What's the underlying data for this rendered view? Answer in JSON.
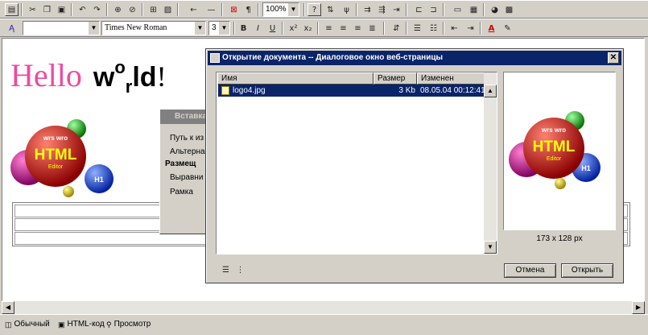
{
  "toolbar1": {
    "zoom": "100%"
  },
  "toolbar2": {
    "style_value": "",
    "font_value": "Times New Roman",
    "size_value": "3"
  },
  "document": {
    "hello": "Hello",
    "w": "w",
    "o": "o",
    "r": "r",
    "ld": "ld",
    "bang": "!",
    "logo_html": "HTML",
    "logo_editor": "Editor",
    "logo_small": "wrs wro",
    "logo_h1": "H1"
  },
  "bg_dialog": {
    "title": "Вставка",
    "labels": [
      "Путь к из",
      "Альтерна",
      "Размещ",
      "Выравни",
      "Рамка"
    ]
  },
  "dialog": {
    "title": "Открытие документа -- Диалоговое окно веб-страницы",
    "columns": [
      "Имя",
      "Размер",
      "Изменен"
    ],
    "files": [
      {
        "name": "logo4.jpg",
        "size": "3 Kb",
        "modified": "08.05.04 00:12:41"
      }
    ],
    "preview_size": "173 x 128 px",
    "cancel_label": "Отмена",
    "open_label": "Открыть"
  },
  "status_tabs": [
    "Обычный",
    "HTML-код",
    "Просмотр"
  ],
  "colors": {
    "titlebar": "#0a246a",
    "selection": "#0a246a",
    "face": "#d4d0c8"
  }
}
